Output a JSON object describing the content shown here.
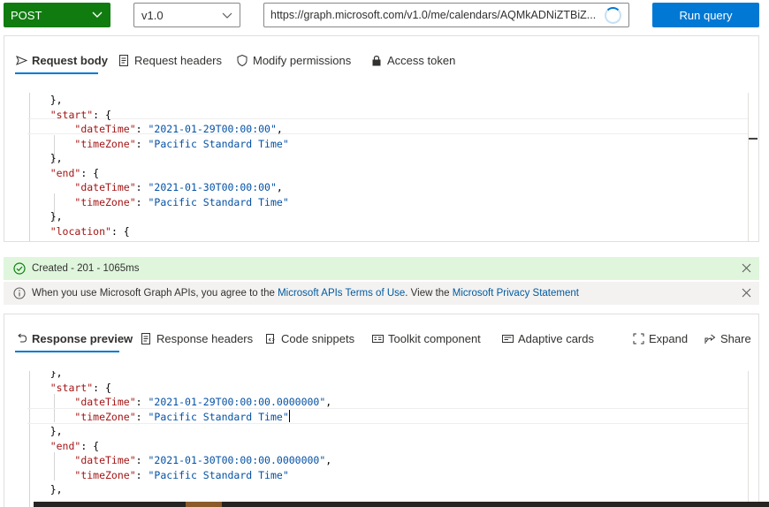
{
  "query": {
    "method": "POST",
    "version": "v1.0",
    "url": "https://graph.microsoft.com/v1.0/me/calendars/AQMkADNiZTBiZ...",
    "run_label": "Run query"
  },
  "request_tabs": [
    {
      "label": "Request body",
      "icon": "send-icon"
    },
    {
      "label": "Request headers",
      "icon": "document-icon"
    },
    {
      "label": "Modify permissions",
      "icon": "shield-icon"
    },
    {
      "label": "Access token",
      "icon": "lock-icon"
    }
  ],
  "request_code": [
    {
      "indent": "    ",
      "parts": [
        [
          "p",
          "},"
        ]
      ]
    },
    {
      "indent": "    ",
      "parts": [
        [
          "k",
          "\"start\""
        ],
        [
          "p",
          ": {"
        ]
      ]
    },
    {
      "indent": "        ",
      "parts": [
        [
          "k",
          "\"dateTime\""
        ],
        [
          "p",
          ": "
        ],
        [
          "s",
          "\"2021-01-29T00:00:00\""
        ],
        [
          "p",
          ","
        ]
      ]
    },
    {
      "indent": "        ",
      "parts": [
        [
          "k",
          "\"timeZone\""
        ],
        [
          "p",
          ": "
        ],
        [
          "s",
          "\"Pacific Standard Time\""
        ]
      ]
    },
    {
      "indent": "    ",
      "parts": [
        [
          "p",
          "},"
        ]
      ]
    },
    {
      "indent": "    ",
      "parts": [
        [
          "k",
          "\"end\""
        ],
        [
          "p",
          ": {"
        ]
      ]
    },
    {
      "indent": "        ",
      "parts": [
        [
          "k",
          "\"dateTime\""
        ],
        [
          "p",
          ": "
        ],
        [
          "s",
          "\"2021-01-30T00:00:00\""
        ],
        [
          "p",
          ","
        ]
      ]
    },
    {
      "indent": "        ",
      "parts": [
        [
          "k",
          "\"timeZone\""
        ],
        [
          "p",
          ": "
        ],
        [
          "s",
          "\"Pacific Standard Time\""
        ]
      ]
    },
    {
      "indent": "    ",
      "parts": [
        [
          "p",
          "},"
        ]
      ]
    },
    {
      "indent": "    ",
      "parts": [
        [
          "k",
          "\"location\""
        ],
        [
          "p",
          ": {"
        ]
      ]
    }
  ],
  "status_message": "Created - 201 - 1065ms",
  "info_message": {
    "prefix": "When you use Microsoft Graph APIs, you agree to the ",
    "link1": "Microsoft APIs Terms of Use",
    "middle": ". View the ",
    "link2": "Microsoft Privacy Statement"
  },
  "response_tabs": [
    {
      "label": "Response preview",
      "icon": "undo-icon"
    },
    {
      "label": "Response headers",
      "icon": "document-icon"
    },
    {
      "label": "Code snippets",
      "icon": "code-icon"
    },
    {
      "label": "Toolkit component",
      "icon": "toolkit-icon"
    },
    {
      "label": "Adaptive cards",
      "icon": "card-icon"
    }
  ],
  "response_actions": [
    {
      "label": "Expand",
      "icon": "expand-icon"
    },
    {
      "label": "Share",
      "icon": "share-icon"
    }
  ],
  "response_code": [
    {
      "indent": "    ",
      "parts": [
        [
          "p",
          "},"
        ]
      ]
    },
    {
      "indent": "    ",
      "parts": [
        [
          "k",
          "\"start\""
        ],
        [
          "p",
          ": {"
        ]
      ]
    },
    {
      "indent": "        ",
      "parts": [
        [
          "k",
          "\"dateTime\""
        ],
        [
          "p",
          ": "
        ],
        [
          "s",
          "\"2021-01-29T00:00:00.0000000\""
        ],
        [
          "p",
          ","
        ]
      ]
    },
    {
      "indent": "        ",
      "parts": [
        [
          "k",
          "\"timeZone\""
        ],
        [
          "p",
          ": "
        ],
        [
          "s",
          "\"Pacific Standard Time\""
        ]
      ]
    },
    {
      "indent": "    ",
      "parts": [
        [
          "p",
          "},"
        ]
      ]
    },
    {
      "indent": "    ",
      "parts": [
        [
          "k",
          "\"end\""
        ],
        [
          "p",
          ": {"
        ]
      ]
    },
    {
      "indent": "        ",
      "parts": [
        [
          "k",
          "\"dateTime\""
        ],
        [
          "p",
          ": "
        ],
        [
          "s",
          "\"2021-01-30T00:00:00.0000000\""
        ],
        [
          "p",
          ","
        ]
      ]
    },
    {
      "indent": "        ",
      "parts": [
        [
          "k",
          "\"timeZone\""
        ],
        [
          "p",
          ": "
        ],
        [
          "s",
          "\"Pacific Standard Time\""
        ]
      ]
    },
    {
      "indent": "    ",
      "parts": [
        [
          "p",
          "},"
        ]
      ]
    }
  ],
  "colors": {
    "method_bg": "#107c10",
    "run_bg": "#0078d4",
    "tab_underline": "#0078d4",
    "success_bg": "#dff6dd",
    "info_bg": "#f3f2f1",
    "json_key": "#a31515",
    "json_string": "#0451a5"
  }
}
